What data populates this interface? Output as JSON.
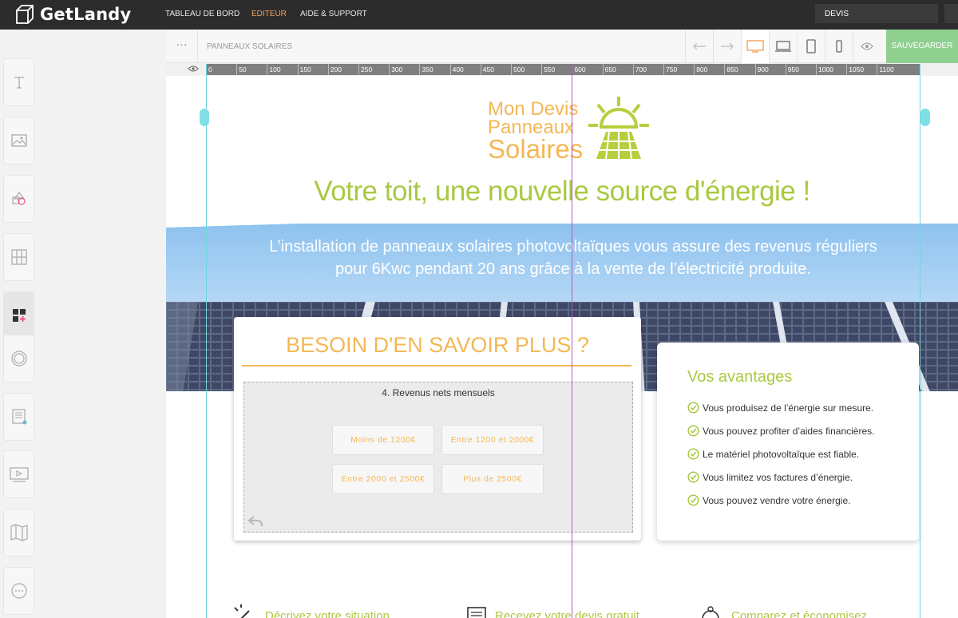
{
  "app": {
    "name": "GetLandy"
  },
  "topnav": {
    "items": [
      "TABLEAU DE BORD",
      "EDITEUR",
      "AIDE & SUPPORT"
    ],
    "active": "EDITEUR"
  },
  "quote_field": {
    "value": "DEVIS"
  },
  "toolbar": {
    "menu": "···",
    "page_title": "PANNEAUX SOLAIRES",
    "save_label": "SAUVEGARDER"
  },
  "ruler": {
    "ticks": [
      "0",
      "50",
      "100",
      "150",
      "200",
      "250",
      "300",
      "350",
      "400",
      "450",
      "500",
      "550",
      "600",
      "650",
      "700",
      "750",
      "800",
      "850",
      "900",
      "950",
      "1000",
      "1050",
      "1100"
    ]
  },
  "page": {
    "brand": {
      "line1": "Mon Devis",
      "line2": "Panneaux",
      "line3": "Solaires"
    },
    "headline": "Votre toit, une nouvelle source d'énergie !",
    "lead": "L’installation de panneaux solaires photovoltaïques vous assure des revenus réguliers pour 6Kwc pendant 20 ans grâce à la vente de l’électricité produite.",
    "form": {
      "title": "BESOIN D'EN SAVOIR PLUS ?",
      "question": "4. Revenus nets mensuels",
      "options": [
        "Moins de 1200€",
        "Entre 1200 et 2000€",
        "Entre 2000 et 2500€",
        "Plus de 2500€"
      ]
    },
    "advantages": {
      "title": "Vos avantages",
      "items": [
        "Vous produisez de l’énergie sur mesure.",
        "Vous pouvez profiter d’aides financières.",
        "Le matériel photovoltaïque est fiable.",
        "Vous limitez vos factures d’énergie.",
        "Vous pouvez vendre votre énergie."
      ]
    },
    "features": [
      "Décrivez votre situation",
      "Recevez votre devis gratuit",
      "Comparez et économisez"
    ]
  },
  "colors": {
    "accent_green": "#a9c941",
    "accent_orange": "#f4b754",
    "active_nav": "#f0a45a",
    "save_button": "#8fcf8f",
    "guide": "#6fd5dc"
  }
}
